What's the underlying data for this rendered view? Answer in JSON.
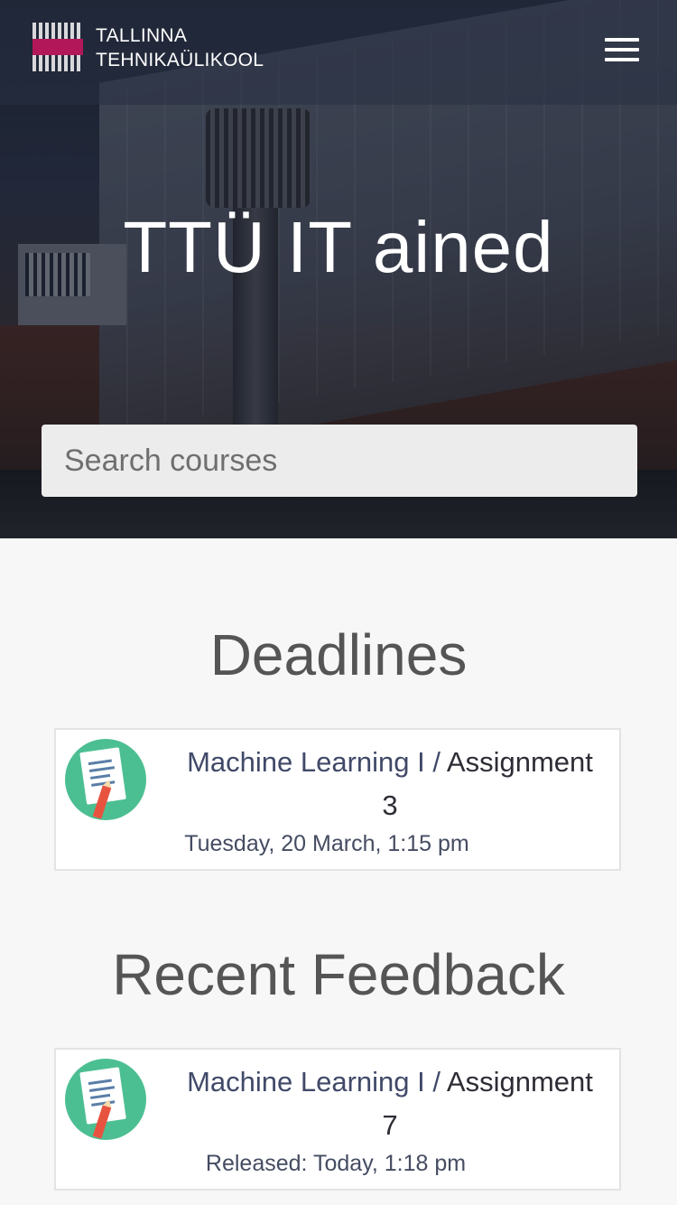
{
  "header": {
    "brand_line1": "TALLINNA",
    "brand_line2": "TEHNIKAÜLIKOOL",
    "menu_icon": "hamburger-menu-icon"
  },
  "hero": {
    "title": "TTÜ IT ained"
  },
  "search": {
    "placeholder": "Search courses",
    "value": ""
  },
  "deadlines": {
    "title": "Deadlines",
    "items": [
      {
        "course": "Machine Learning I",
        "separator": "/",
        "assignment_line1": "Assignment",
        "assignment_line2": "3",
        "date": "Tuesday, 20 March, 1:15 pm"
      }
    ]
  },
  "feedback": {
    "title": "Recent Feedback",
    "items": [
      {
        "course": "Machine Learning I",
        "separator": "/",
        "assignment_line1": "Assignment",
        "assignment_line2": "7",
        "date": "Released: Today, 1:18 pm"
      }
    ]
  },
  "colors": {
    "brand_accent": "#b2175a",
    "icon_green": "#4cbf92",
    "background": "#f7f7f7"
  }
}
